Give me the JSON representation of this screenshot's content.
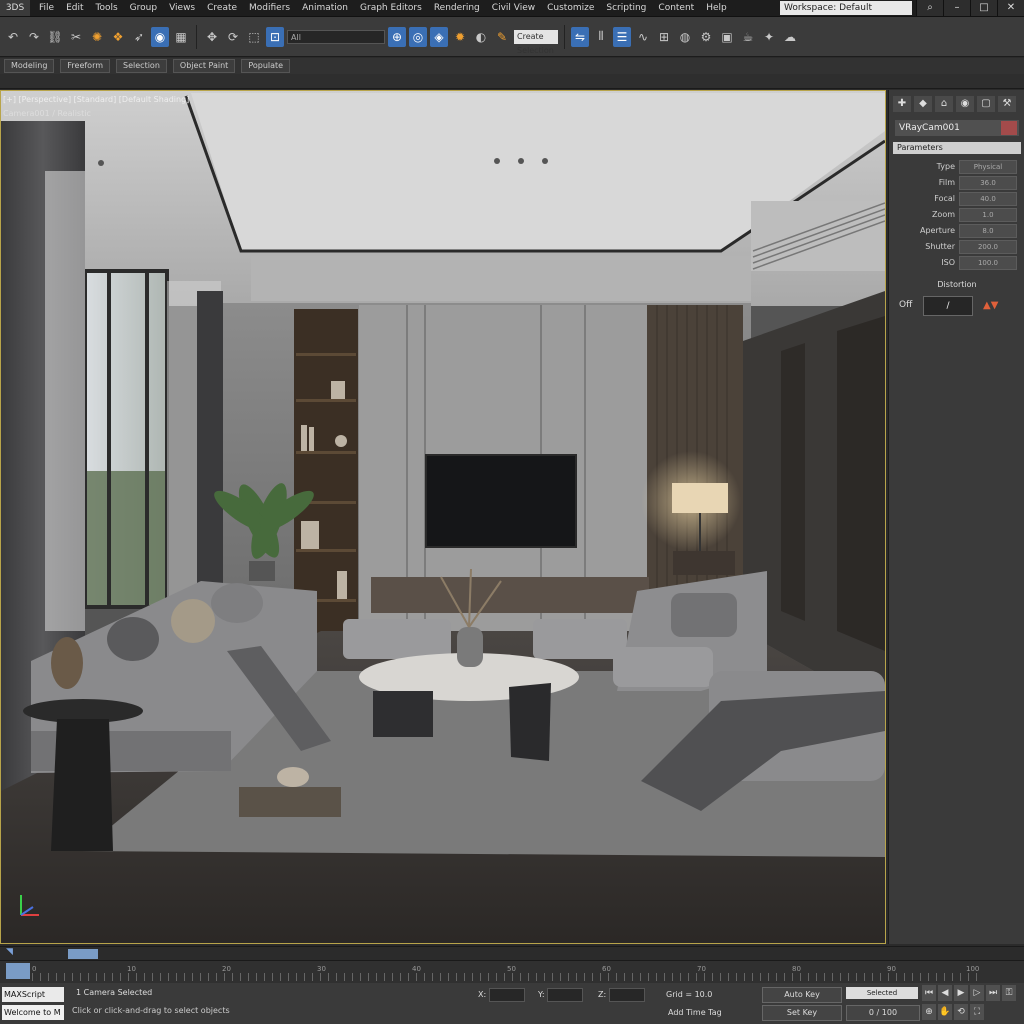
{
  "app": {
    "title": "3DS"
  },
  "menu": {
    "items": [
      "File",
      "Edit",
      "Tools",
      "Group",
      "Views",
      "Create",
      "Modifiers",
      "Animation",
      "Graph Editors",
      "Rendering",
      "Civil View",
      "Customize",
      "Scripting",
      "Content",
      "Help"
    ]
  },
  "workspace": {
    "label": "Workspace: Default"
  },
  "toolbar": {
    "selection_filter": "All",
    "named_set": "Create Selection Set"
  },
  "ribbon": {
    "buttons": [
      "Modeling",
      "Freeform",
      "Selection",
      "Object Paint",
      "Populate"
    ]
  },
  "viewport": {
    "label": "[+] [Perspective] [Standard] [Default Shading]",
    "sublabel": "Camera001 / Realistic"
  },
  "command_panel": {
    "tabs": [
      "create-icon",
      "modify-icon",
      "hierarchy-icon",
      "motion-icon",
      "display-icon",
      "utilities-icon"
    ],
    "object_name": "VRayCam001",
    "rollout_title": "Parameters",
    "rows": [
      {
        "label": "Type",
        "value": "Physical"
      },
      {
        "label": "Film",
        "value": "36.0"
      },
      {
        "label": "Focal",
        "value": "40.0"
      },
      {
        "label": "Zoom",
        "value": "1.0"
      },
      {
        "label": "Aperture",
        "value": "8.0"
      },
      {
        "label": "Shutter",
        "value": "200.0"
      },
      {
        "label": "ISO",
        "value": "100.0"
      }
    ],
    "subheader_label": "Distortion",
    "spinner_label": "Off",
    "spinner_value": "/"
  },
  "timeline": {
    "frame_label": "0 / 100",
    "ticks": [
      "0",
      "10",
      "20",
      "30",
      "40",
      "50",
      "60",
      "70",
      "80",
      "90",
      "100"
    ]
  },
  "status": {
    "script_label": "MAXScript",
    "script_label2": "Welcome to M",
    "selection": "1 Camera Selected",
    "prompt": "Click or click-and-drag to select objects",
    "x_label": "X:",
    "y_label": "Y:",
    "z_label": "Z:",
    "grid": "Grid = 10.0",
    "add_time_tag": "Add Time Tag",
    "auto_key": "Auto Key",
    "set_key": "Set Key",
    "selected_label": "Selected"
  }
}
